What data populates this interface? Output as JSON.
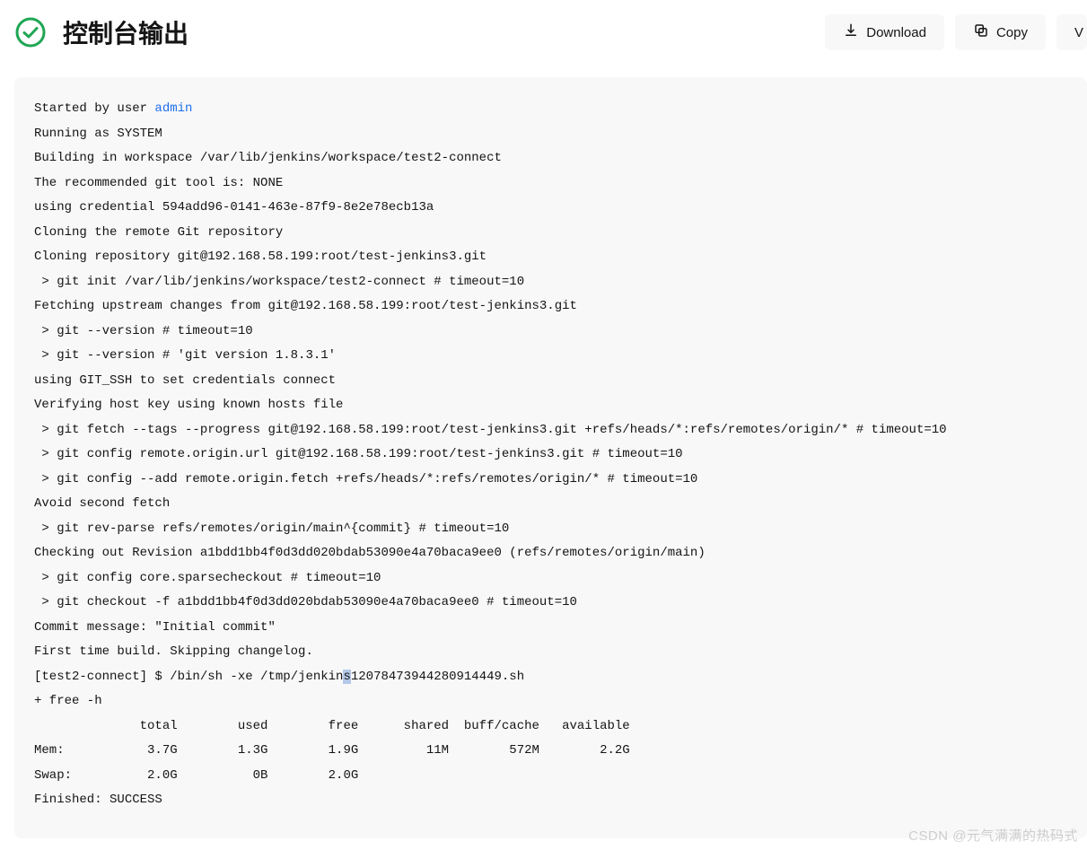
{
  "header": {
    "title": "控制台输出",
    "status": "success",
    "buttons": {
      "download_label": "Download",
      "copy_label": "Copy",
      "third_label": "V"
    }
  },
  "console": {
    "lines": [
      {
        "type": "plain",
        "text": "Started by user "
      },
      {
        "type": "link",
        "text": "admin"
      },
      {
        "type": "break"
      },
      {
        "type": "plain",
        "text": "Running as SYSTEM"
      },
      {
        "type": "break"
      },
      {
        "type": "plain",
        "text": "Building in workspace /var/lib/jenkins/workspace/test2-connect"
      },
      {
        "type": "break"
      },
      {
        "type": "plain",
        "text": "The recommended git tool is: NONE"
      },
      {
        "type": "break"
      },
      {
        "type": "plain",
        "text": "using credential 594add96-0141-463e-87f9-8e2e78ecb13a"
      },
      {
        "type": "break"
      },
      {
        "type": "plain",
        "text": "Cloning the remote Git repository"
      },
      {
        "type": "break"
      },
      {
        "type": "plain",
        "text": "Cloning repository git@192.168.58.199:root/test-jenkins3.git"
      },
      {
        "type": "break"
      },
      {
        "type": "plain",
        "text": " > git init /var/lib/jenkins/workspace/test2-connect # timeout=10"
      },
      {
        "type": "break"
      },
      {
        "type": "plain",
        "text": "Fetching upstream changes from git@192.168.58.199:root/test-jenkins3.git"
      },
      {
        "type": "break"
      },
      {
        "type": "plain",
        "text": " > git --version # timeout=10"
      },
      {
        "type": "break"
      },
      {
        "type": "plain",
        "text": " > git --version # 'git version 1.8.3.1'"
      },
      {
        "type": "break"
      },
      {
        "type": "plain",
        "text": "using GIT_SSH to set credentials connect"
      },
      {
        "type": "break"
      },
      {
        "type": "plain",
        "text": "Verifying host key using known hosts file"
      },
      {
        "type": "break"
      },
      {
        "type": "plain",
        "text": " > git fetch --tags --progress git@192.168.58.199:root/test-jenkins3.git +refs/heads/*:refs/remotes/origin/* # timeout=10"
      },
      {
        "type": "break"
      },
      {
        "type": "plain",
        "text": " > git config remote.origin.url git@192.168.58.199:root/test-jenkins3.git # timeout=10"
      },
      {
        "type": "break"
      },
      {
        "type": "plain",
        "text": " > git config --add remote.origin.fetch +refs/heads/*:refs/remotes/origin/* # timeout=10"
      },
      {
        "type": "break"
      },
      {
        "type": "plain",
        "text": "Avoid second fetch"
      },
      {
        "type": "break"
      },
      {
        "type": "plain",
        "text": " > git rev-parse refs/remotes/origin/main^{commit} # timeout=10"
      },
      {
        "type": "break"
      },
      {
        "type": "plain",
        "text": "Checking out Revision a1bdd1bb4f0d3dd020bdab53090e4a70baca9ee0 (refs/remotes/origin/main)"
      },
      {
        "type": "break"
      },
      {
        "type": "plain",
        "text": " > git config core.sparsecheckout # timeout=10"
      },
      {
        "type": "break"
      },
      {
        "type": "plain",
        "text": " > git checkout -f a1bdd1bb4f0d3dd020bdab53090e4a70baca9ee0 # timeout=10"
      },
      {
        "type": "break"
      },
      {
        "type": "plain",
        "text": "Commit message: \"Initial commit\""
      },
      {
        "type": "break"
      },
      {
        "type": "plain",
        "text": "First time build. Skipping changelog."
      },
      {
        "type": "break"
      },
      {
        "type": "plain",
        "text": "[test2-connect] $ /bin/sh -xe /tmp/jenkin"
      },
      {
        "type": "highlight",
        "text": "s"
      },
      {
        "type": "plain",
        "text": "12078473944280914449.sh"
      },
      {
        "type": "break"
      },
      {
        "type": "plain",
        "text": "+ free -h"
      },
      {
        "type": "break"
      },
      {
        "type": "plain",
        "text": "              total        used        free      shared  buff/cache   available"
      },
      {
        "type": "break"
      },
      {
        "type": "plain",
        "text": "Mem:           3.7G        1.3G        1.9G         11M        572M        2.2G"
      },
      {
        "type": "break"
      },
      {
        "type": "plain",
        "text": "Swap:          2.0G          0B        2.0G"
      },
      {
        "type": "break"
      },
      {
        "type": "plain",
        "text": "Finished: SUCCESS"
      }
    ]
  },
  "watermark": "CSDN @元气满满的热码式"
}
